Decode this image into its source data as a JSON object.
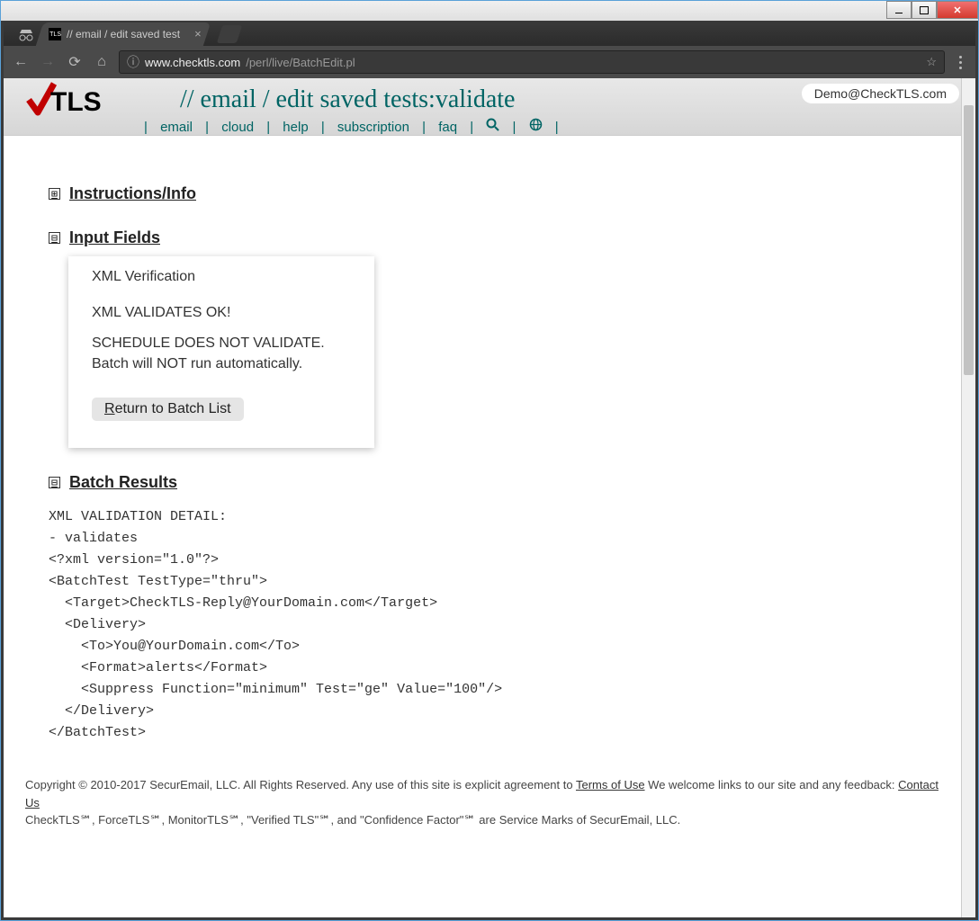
{
  "window": {
    "tab_title": "// email / edit saved test",
    "favicon_text": "TLS"
  },
  "addressbar": {
    "host": "www.checktls.com",
    "path": "/perl/live/BatchEdit.pl"
  },
  "header": {
    "title": "// email / edit saved tests:validate",
    "user": "Demo@CheckTLS.com",
    "nav": {
      "email": "email",
      "cloud": "cloud",
      "help": "help",
      "subscription": "subscription",
      "faq": "faq"
    }
  },
  "sections": {
    "instructions": "Instructions/Info",
    "input_fields": "Input Fields",
    "batch_results": "Batch Results"
  },
  "input_card": {
    "subtitle": "XML Verification",
    "ok": "XML VALIDATES OK!",
    "fail_line1": "SCHEDULE DOES NOT VALIDATE.",
    "fail_line2": "Batch will NOT run automatically.",
    "return_btn_text": "eturn to Batch List",
    "return_btn_key": "R"
  },
  "results": {
    "heading": "XML VALIDATION DETAIL:",
    "lines": [
      "- validates",
      "<?xml version=\"1.0\"?>",
      "<BatchTest TestType=\"thru\">",
      "  <Target>CheckTLS-Reply@YourDomain.com</Target>",
      "  <Delivery>",
      "    <To>You@YourDomain.com</To>",
      "    <Format>alerts</Format>",
      "    <Suppress Function=\"minimum\" Test=\"ge\" Value=\"100\"/>",
      "  </Delivery>",
      "</BatchTest>"
    ]
  },
  "footer": {
    "line1a": "Copyright © 2010-2017 SecurEmail, LLC. All Rights Reserved. Any use of this site is explicit agreement to ",
    "terms": "Terms of Use",
    "line1b": " We welcome links to our site and any feedback: ",
    "contact": "Contact Us",
    "line2": "CheckTLS℠, ForceTLS℠, MonitorTLS℠, \"Verified TLS\"℠, and \"Confidence Factor\"℠ are Service Marks of SecurEmail, LLC."
  }
}
